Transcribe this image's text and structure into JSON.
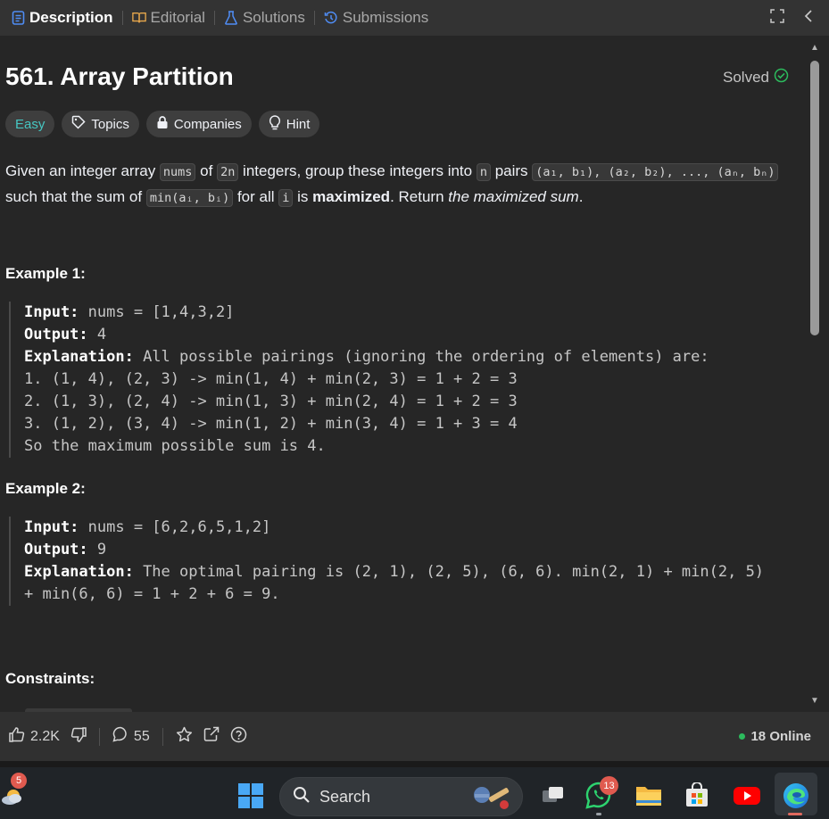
{
  "tabs": [
    {
      "label": "Description",
      "icon": "description-icon",
      "active": true
    },
    {
      "label": "Editorial",
      "icon": "book-icon",
      "active": false
    },
    {
      "label": "Solutions",
      "icon": "flask-icon",
      "active": false
    },
    {
      "label": "Submissions",
      "icon": "history-icon",
      "active": false
    }
  ],
  "problem": {
    "title": "561. Array Partition",
    "status": "Solved",
    "tags": {
      "difficulty": "Easy",
      "topics": "Topics",
      "companies": "Companies",
      "hint": "Hint"
    }
  },
  "description": {
    "p1": "Given an integer array ",
    "c1": "nums",
    "p2": " of ",
    "c2": "2n",
    "p3": " integers, group these integers into ",
    "c3": "n",
    "p4": " pairs ",
    "c4": "(a₁, b₁), (a₂, b₂), ..., (aₙ, bₙ)",
    "p5": " such that the sum of ",
    "c5": "min(aᵢ, bᵢ)",
    "p6": " for all ",
    "c6": "i",
    "p7": " is ",
    "b1": "maximized",
    "p8": ". Return ",
    "i1": "the maximized sum",
    "p9": "."
  },
  "example1": {
    "heading": "Example 1:",
    "input_label": "Input:",
    "input": " nums = [1,4,3,2]",
    "output_label": "Output:",
    "output": " 4",
    "explanation_label": "Explanation:",
    "explanation": " All possible pairings (ignoring the ordering of elements) are:",
    "lines": [
      "1. (1, 4), (2, 3) -> min(1, 4) + min(2, 3) = 1 + 2 = 3",
      "2. (1, 3), (2, 4) -> min(1, 3) + min(2, 4) = 1 + 2 = 3",
      "3. (1, 2), (3, 4) -> min(1, 2) + min(3, 4) = 1 + 3 = 4",
      "So the maximum possible sum is 4."
    ]
  },
  "example2": {
    "heading": "Example 2:",
    "input_label": "Input:",
    "input": " nums = [6,2,6,5,1,2]",
    "output_label": "Output:",
    "output": " 9",
    "explanation_label": "Explanation:",
    "explanation": " The optimal pairing is (2, 1), (2, 5), (6, 6). min(2, 1) + min(2, 5)",
    "explanation_cont": "+ min(6, 6) = 1 + 2 + 6 = 9."
  },
  "constraints_heading": "Constraints:",
  "footer": {
    "likes": "2.2K",
    "comments": "55",
    "online": "18 Online"
  },
  "taskbar": {
    "search_label": "Search",
    "weather_badge": "5",
    "whatsapp_badge": "13"
  },
  "colors": {
    "easy": "#46c6c2",
    "solved_check": "#2cbb5d",
    "online_dot": "#2cbb5d"
  }
}
